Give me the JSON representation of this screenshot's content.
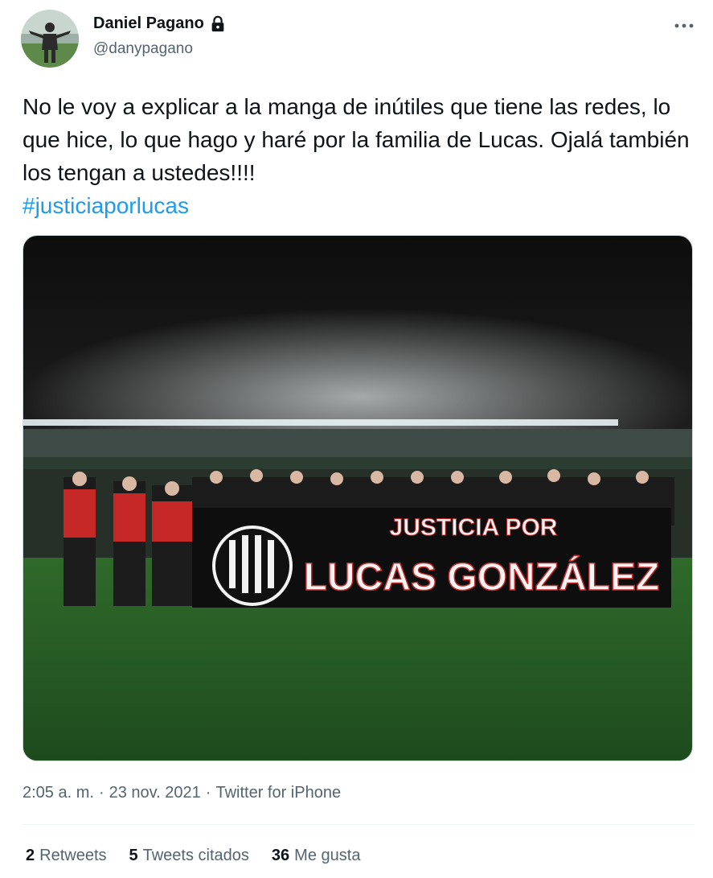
{
  "author": {
    "name": "Daniel Pagano",
    "handle": "@danypagano",
    "icons": {
      "avatar": "avatar-photo",
      "protected": "lock-icon",
      "more": "more-icon"
    }
  },
  "tweet": {
    "text": "No le voy a explicar a la manga de inútiles que tiene las redes, lo que hice, lo que hago y haré por la familia de Lucas. Ojalá también los tengan a ustedes!!!!",
    "hashtag": "#justiciaporlucas",
    "banner_line1": "JUSTICIA POR",
    "banner_line2": "LUCAS GONZÁLEZ"
  },
  "meta": {
    "time": "2:05 a. m.",
    "separator1": "·",
    "date": "23 nov. 2021",
    "separator2": "·",
    "source": "Twitter for iPhone"
  },
  "stats": {
    "retweets_count": "2",
    "retweets_label": "Retweets",
    "quotes_count": "5",
    "quotes_label": "Tweets citados",
    "likes_count": "36",
    "likes_label": "Me gusta"
  },
  "colors": {
    "link": "#1d9bf0",
    "secondary": "#536471",
    "primary": "#0f1419"
  }
}
